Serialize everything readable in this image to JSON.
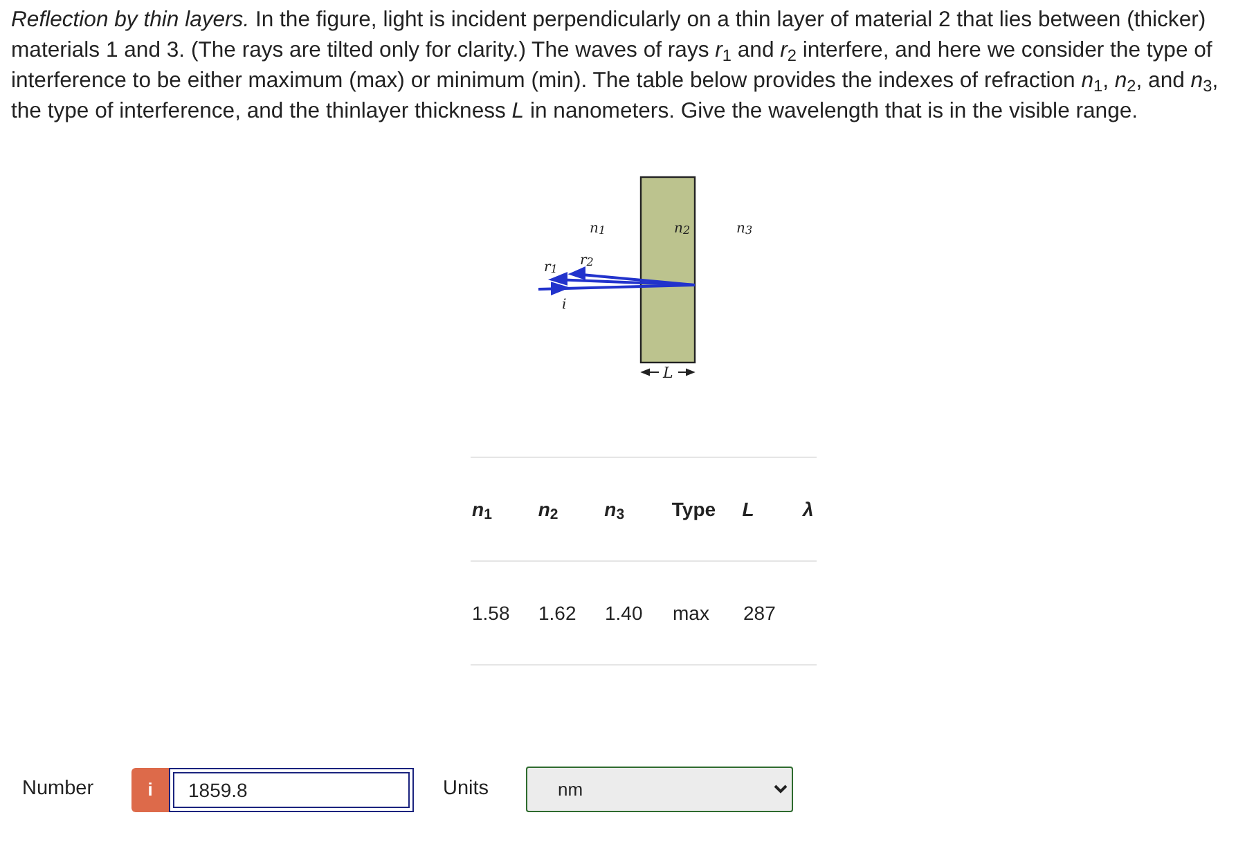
{
  "question": {
    "text": "*Reflection by thin layers.* In the figure, light is incident perpendicularly on a thin layer of material 2 that lies between (thicker) materials 1 and 3. (The rays are tilted only for clarity.) The waves of rays *r*$_{1}$ and *r*$_{2}$ interfere, and here we consider the type of interference to be either maximum (max) or minimum (min). The table below provides the indexes of refraction *n*$_{1}$, *n*$_{2}$, and *n*$_{3}$, the type of interference, and the thinlayer thickness *L* in nanometers. Give the wavelength that is in the visible range."
  },
  "figure": {
    "labels": [
      {
        "kind": "n",
        "text": "n",
        "sub": "1"
      },
      {
        "kind": "n",
        "text": "n",
        "sub": "2"
      },
      {
        "kind": "n",
        "text": "n",
        "sub": "3"
      },
      {
        "kind": "r",
        "text": "r",
        "sub": "1"
      },
      {
        "kind": "r",
        "text": "r",
        "sub": "2"
      },
      {
        "kind": "i",
        "text": "i"
      },
      {
        "kind": "L",
        "text": "L"
      }
    ]
  },
  "table": {
    "columns": [
      "*n*$_{1}$",
      "*n*$_{2}$",
      "*n*$_{3}$",
      "Type",
      "*L*",
      "*λ*"
    ],
    "rows": [
      [
        "1.58",
        "1.62",
        "1.40",
        "max",
        "287"
      ]
    ]
  },
  "answer": {
    "label": "Number",
    "info": "i",
    "value": "1859.8",
    "units_label": "Units",
    "units": "nm"
  }
}
